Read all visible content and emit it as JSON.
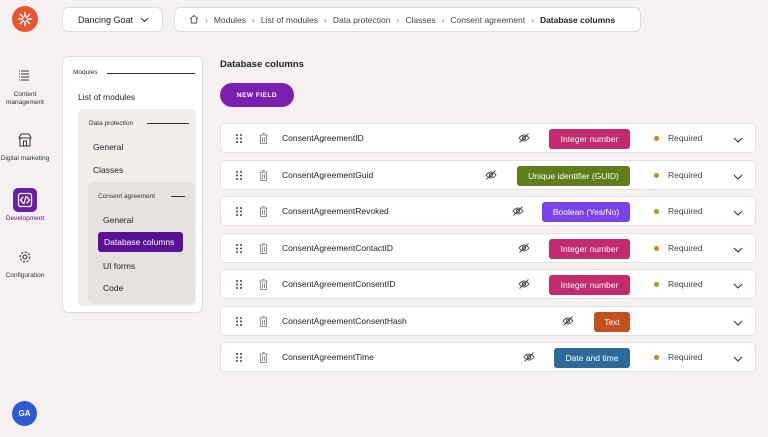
{
  "site_selector": {
    "label": "Dancing Goat"
  },
  "breadcrumb": [
    {
      "label": "Modules"
    },
    {
      "label": "List of modules"
    },
    {
      "label": "Data protection"
    },
    {
      "label": "Classes"
    },
    {
      "label": "Consent agreement"
    },
    {
      "label": "Database columns"
    }
  ],
  "rail": {
    "items": [
      {
        "label": "Content management",
        "icon": "content-icon"
      },
      {
        "label": "Digital marketing",
        "icon": "store-icon"
      },
      {
        "label": "Development",
        "icon": "code-icon",
        "active": true
      },
      {
        "label": "Configuration",
        "icon": "gear-icon"
      }
    ],
    "avatar": "GA"
  },
  "nav": {
    "section": "Modules",
    "list_link": "List of modules",
    "group": "Data protection",
    "group_items": [
      "General",
      "Classes"
    ],
    "subgroup": "Consent agreement",
    "sub_items": [
      "General",
      "Database columns",
      "UI forms",
      "Code"
    ],
    "active": "Database columns"
  },
  "main": {
    "title": "Database columns",
    "new_field_label": "NEW FIELD",
    "required_label": "Required",
    "columns": [
      {
        "name": "ConsentAgreementID",
        "type": "Integer number",
        "color": "#c42a6e",
        "required": true
      },
      {
        "name": "ConsentAgreementGuid",
        "type": "Unique identifier (GUID)",
        "color": "#5e7d1c",
        "required": true
      },
      {
        "name": "ConsentAgreementRevoked",
        "type": "Boolean (Yes/No)",
        "color": "#7a43ea",
        "required": true
      },
      {
        "name": "ConsentAgreementContactID",
        "type": "Integer number",
        "color": "#c42a6e",
        "required": true
      },
      {
        "name": "ConsentAgreementConsentID",
        "type": "Integer number",
        "color": "#c42a6e",
        "required": true
      },
      {
        "name": "ConsentAgreementConsentHash",
        "type": "Text",
        "color": "#c4501f",
        "required": false
      },
      {
        "name": "ConsentAgreementTime",
        "type": "Date and time",
        "color": "#2f6a9c",
        "required": true
      }
    ]
  }
}
